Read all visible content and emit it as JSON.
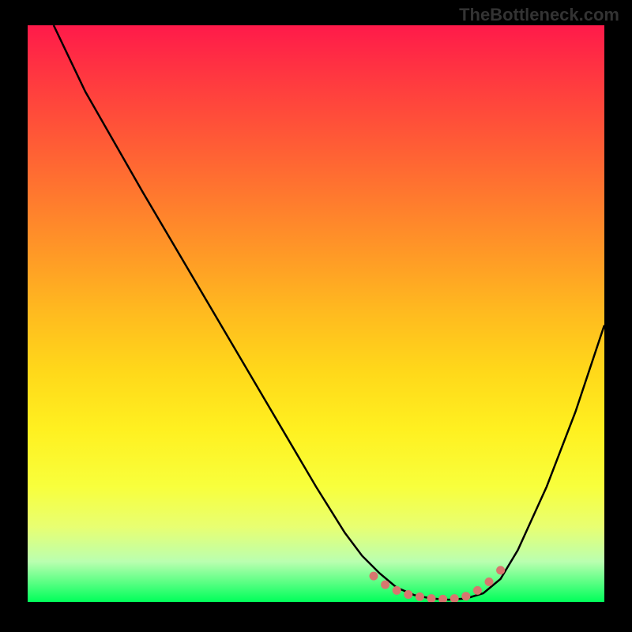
{
  "watermark": "TheBottleneck.com",
  "chart_data": {
    "type": "line",
    "title": "",
    "xlabel": "",
    "ylabel": "",
    "xlim": [
      0,
      100
    ],
    "ylim": [
      0,
      100
    ],
    "series": [
      {
        "name": "curve",
        "x": [
          4.5,
          10,
          20,
          30,
          40,
          50,
          55,
          58,
          61,
          64,
          67,
          70,
          73,
          76,
          79,
          82,
          85,
          90,
          95,
          100
        ],
        "y": [
          100,
          88.5,
          71,
          54,
          37,
          20,
          12,
          8,
          5,
          2.5,
          1.2,
          0.6,
          0.4,
          0.6,
          1.5,
          4,
          9,
          20,
          33,
          48
        ]
      }
    ],
    "markers": {
      "description": "salmon dots along the valley floor segment",
      "x": [
        60,
        62,
        64,
        66,
        68,
        70,
        72,
        74,
        76,
        78,
        80,
        82
      ],
      "y": [
        4.5,
        3,
        2,
        1.3,
        0.9,
        0.6,
        0.5,
        0.6,
        1.0,
        2.0,
        3.5,
        5.5
      ]
    }
  },
  "colors": {
    "curve": "#000000",
    "marker": "#d8766f",
    "background_frame": "#000000"
  }
}
